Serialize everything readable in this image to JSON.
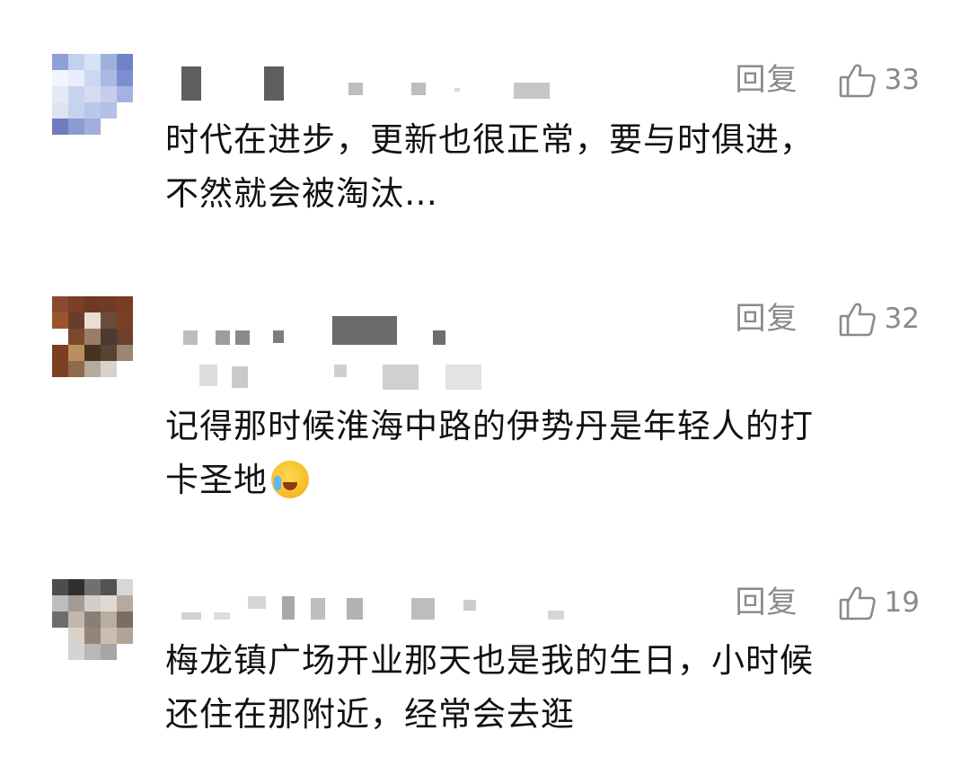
{
  "comments": [
    {
      "reply_label": "回复",
      "like_count": "33",
      "lines": [
        "时代在进步，更新也很正常，要与时俱进，",
        "不然就会被淘汰…"
      ]
    },
    {
      "reply_label": "回复",
      "like_count": "32",
      "lines": [
        "记得那时候淮海中路的伊势丹是年轻人的打",
        "卡圣地"
      ],
      "emoji": "face-with-tears-of-joy"
    },
    {
      "reply_label": "回复",
      "like_count": "19",
      "lines": [
        "梅龙镇广场开业那天也是我的生日，小时候",
        "还住在那附近，经常会去逛"
      ]
    }
  ],
  "colors": {
    "meta_text": "#8a8a8a",
    "body_text": "#111111",
    "background": "#ffffff"
  },
  "icons": {
    "like": "thumbs-up-outline-icon"
  }
}
